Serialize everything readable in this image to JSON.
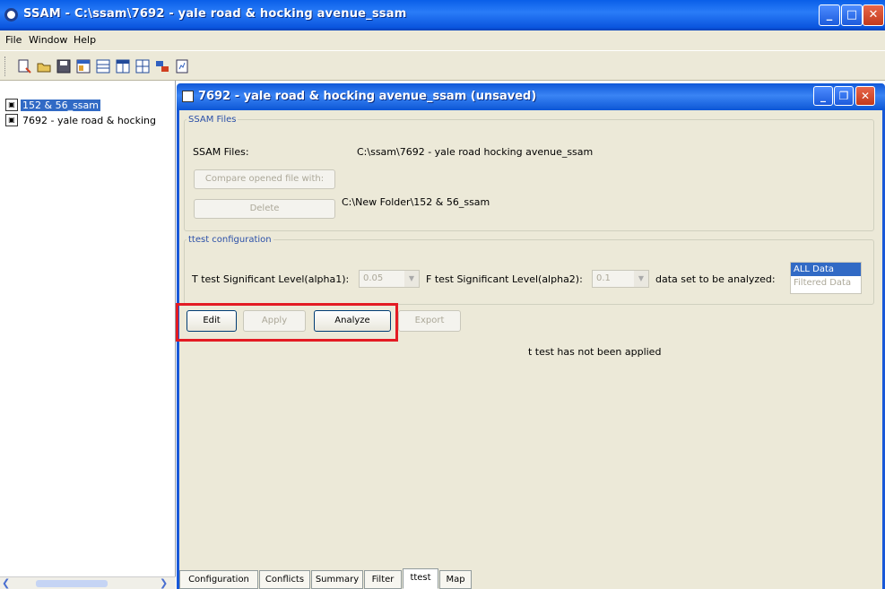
{
  "window": {
    "title": "SSAM - C:\\ssam\\7692 - yale road & hocking avenue_ssam"
  },
  "menu": [
    "File",
    "Window",
    "Help"
  ],
  "toolbar_icons": [
    "new-project-icon",
    "open-icon",
    "save-icon",
    "compare-icon",
    "list-icon",
    "grid-icon",
    "table-icon",
    "chart-icon",
    "report-icon"
  ],
  "tree": {
    "items": [
      {
        "label": "152 & 56_ssam",
        "selected": true
      },
      {
        "label": "7692 - yale road & hocking",
        "selected": false
      }
    ]
  },
  "frame": {
    "title": "7692 - yale road & hocking avenue_ssam (unsaved)"
  },
  "ssam_files": {
    "legend": "SSAM Files",
    "label": "SSAM Files:",
    "file1": "C:\\ssam\\7692 - yale road  hocking avenue_ssam",
    "file2": "C:\\New Folder\\152 & 56_ssam",
    "compare_label": "Compare opened file with:",
    "delete_label": "Delete"
  },
  "ttest": {
    "legend": "ttest configuration",
    "t_label": "T test Significant Level(alpha1):",
    "t_value": "0.05",
    "f_label": "F test Significant Level(alpha2):",
    "f_value": "0.1",
    "data_label": "data set to be analyzed:",
    "data_options": [
      {
        "label": "ALL Data",
        "selected": true
      },
      {
        "label": "Filtered Data",
        "selected": false
      }
    ]
  },
  "actions": {
    "edit": "Edit",
    "apply": "Apply",
    "analyze": "Analyze",
    "export": "Export"
  },
  "status_text": "t test has not been applied",
  "tabs": [
    {
      "label": "Configuration"
    },
    {
      "label": "Conflicts"
    },
    {
      "label": "Summary"
    },
    {
      "label": "Filter"
    },
    {
      "label": "ttest",
      "active": true
    },
    {
      "label": "Map"
    }
  ]
}
